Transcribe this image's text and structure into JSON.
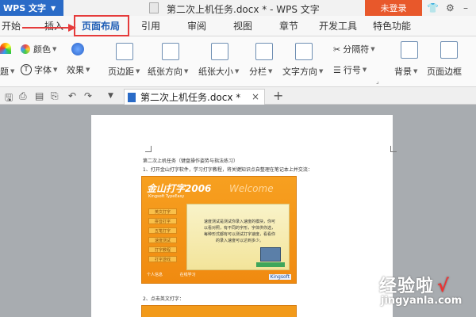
{
  "titlebar": {
    "app_button": "WPS 文字",
    "window_title": "第二次上机任务.docx * - WPS 文字",
    "login_button": "未登录",
    "icons": [
      "shirt-icon",
      "settings-icon",
      "minimize-icon"
    ]
  },
  "menu": {
    "tabs": [
      "开始",
      "插入",
      "页面布局",
      "引用",
      "审阅",
      "视图",
      "章节",
      "开发工具",
      "特色功能"
    ],
    "active_tab": "页面布局"
  },
  "ribbon": {
    "color_label": "颜色",
    "font_label": "字体",
    "effect_label": "效果",
    "theme_label": "题",
    "margins_label": "页边距",
    "orientation_label": "纸张方向",
    "size_label": "纸张大小",
    "columns_label": "分栏",
    "text_direction_label": "文字方向",
    "separator_label": "分隔符",
    "line_numbers_label": "行号",
    "background_label": "背景",
    "page_border_label": "页面边框"
  },
  "doc_tabs": {
    "active_doc": "第二次上机任务.docx *"
  },
  "document": {
    "line1": "第二次上机任务（键盘操作姿势与指法练习）",
    "line2": "1、打开金山打字软件，学习打字教程，将关键知识点自整理在笔记本上并交流：",
    "line3": "2、点击英文打字：",
    "embedded": {
      "logo": "金山打字2006",
      "logo_sub": "Kingsoft TypeEasy",
      "watermark": "Welcome",
      "menu_buttons": [
        "英文打字",
        "拼音打字",
        "五笔打字",
        "速度测试",
        "打字教程",
        "打字游戏"
      ],
      "panel_text": "速度测试是测试你录入速度的模块，你可以看对照，有不同的字形，字体供你选，每种形式都有可以测试打字速度，看看你的录入速度可以达到多少。",
      "footer_left": "个人信息",
      "footer_mid": "在线学习",
      "brand": "Kingsoft"
    }
  },
  "site_watermark": {
    "text": "经验啦",
    "check": "√",
    "url": "jingyanla.com"
  }
}
